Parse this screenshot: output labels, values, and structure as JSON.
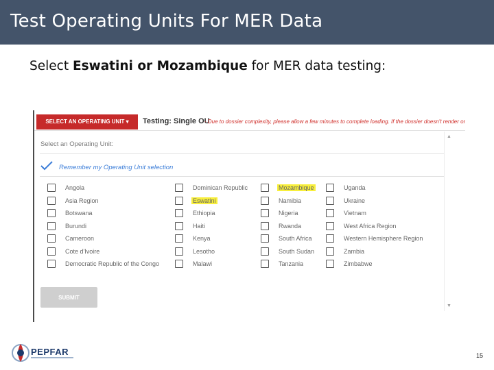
{
  "slide": {
    "title": "Test Operating Units For MER Data",
    "instruction_prefix": "Select ",
    "instruction_bold": "Eswatini or Mozambique",
    "instruction_suffix": " for MER data testing:",
    "page_number": "15"
  },
  "dossier": {
    "select_button_label": "SELECT AN OPERATING UNIT ▾",
    "testing_label": "Testing: Single OU",
    "testing_note": "- Due to dossier complexity, please allow a few minutes to complete loading. If the dossier doesn't render or if you expe",
    "select_label": "Select an Operating Unit:",
    "remember_label": "Remember my Operating Unit selection",
    "submit_label": "SUBMIT",
    "highlight_color": "#f8ef3c",
    "button_color": "#c62a2a",
    "columns": [
      {
        "items": [
          "Angola",
          "Asia Region",
          "Botswana",
          "Burundi",
          "Cameroon",
          "Cote d'Ivoire",
          "Democratic Republic of the Congo"
        ]
      },
      {
        "items": [
          "Dominican Republic",
          "Eswatini",
          "Ethiopia",
          "Haiti",
          "Kenya",
          "Lesotho",
          "Malawi"
        ]
      },
      {
        "items": [
          "Mozambique",
          "Namibia",
          "Nigeria",
          "Rwanda",
          "South Africa",
          "South Sudan",
          "Tanzania"
        ]
      },
      {
        "items": [
          "Uganda",
          "Ukraine",
          "Vietnam",
          "West Africa Region",
          "Western Hemisphere Region",
          "Zambia",
          "Zimbabwe"
        ]
      }
    ],
    "highlighted": [
      "Eswatini",
      "Mozambique"
    ]
  },
  "logo": {
    "name": "PEPFAR"
  }
}
